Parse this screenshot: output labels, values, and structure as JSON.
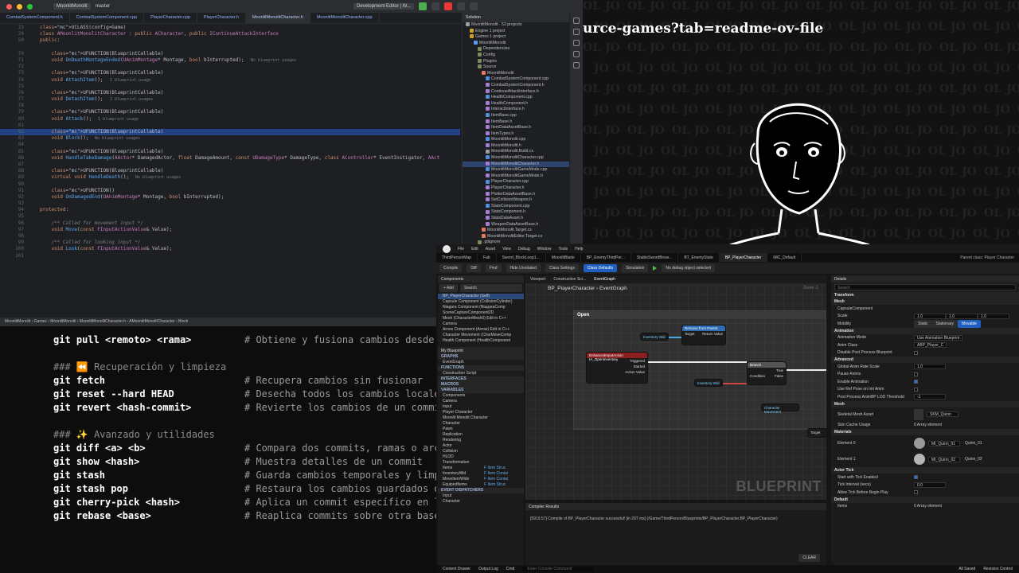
{
  "ide": {
    "menu": {
      "project": "MoonlitMonolit",
      "branch": "master",
      "config": "Development Editor | W..."
    },
    "tabs": [
      "CombatSystemComponent.h",
      "CombatSystemComponent.cpp",
      "PlayerCharacter.cpp",
      "PlayerCharacter.h",
      "MoonlitMonolitCharacter.h",
      "MoonlitMonolitCharacter.cpp"
    ],
    "code": [
      {
        "n": "23",
        "t": "UCLASS(config=Game)"
      },
      {
        "n": "24",
        "t": "class AMoonlitMonolitCharacter : public ACharacter, public IContinueAttackInterface"
      },
      {
        "n": "50",
        "t": "public:"
      },
      {
        "n": "",
        "t": ""
      },
      {
        "n": "70",
        "t": "    UFUNCTION(BlueprintCallable)"
      },
      {
        "n": "71",
        "t": "    void OnDeathMontageEnded(UAnimMontage* Montage, bool bInterrupted);",
        "hint": "No blueprint usages"
      },
      {
        "n": "72",
        "t": ""
      },
      {
        "n": "73",
        "t": "    UFUNCTION(BlueprintCallable)"
      },
      {
        "n": "74",
        "t": "    void AttachItem();",
        "hint": "1 blueprint usage"
      },
      {
        "n": "75",
        "t": ""
      },
      {
        "n": "76",
        "t": "    UFUNCTION(BlueprintCallable)"
      },
      {
        "n": "77",
        "t": "    void DetachItem();",
        "hint": "2 blueprint usages"
      },
      {
        "n": "78",
        "t": ""
      },
      {
        "n": "79",
        "t": "    UFUNCTION(BlueprintCallable)"
      },
      {
        "n": "80",
        "t": "    void Attack();",
        "hint": "1 blueprint usage"
      },
      {
        "n": "81",
        "t": ""
      },
      {
        "n": "82",
        "t": "    UFUNCTION(BlueprintCallable)",
        "hl": true
      },
      {
        "n": "83",
        "t": "    void Block();",
        "hint": "No blueprint usages"
      },
      {
        "n": "84",
        "t": ""
      },
      {
        "n": "85",
        "t": "    UFUNCTION(BlueprintCallable)"
      },
      {
        "n": "86",
        "t": "    void HandleTakeDamage(AActor* DamagedActor, float DamageAmount, const UDamageType* DamageType, class AController* EventInstigator, AAct"
      },
      {
        "n": "87",
        "t": ""
      },
      {
        "n": "88",
        "t": "    UFUNCTION(BlueprintCallable)"
      },
      {
        "n": "89",
        "t": "    virtual void HandleDeath();",
        "hint": "No blueprint usages"
      },
      {
        "n": "90",
        "t": ""
      },
      {
        "n": "91",
        "t": "    UFUNCTION()"
      },
      {
        "n": "92",
        "t": "    void OnDamagedEnd(UAnimMontage* Montage, bool bInterrupted);"
      },
      {
        "n": "93",
        "t": ""
      },
      {
        "n": "94",
        "t": "protected:"
      },
      {
        "n": "95",
        "t": ""
      },
      {
        "n": "96",
        "t": "    /** Called for movement input */"
      },
      {
        "n": "97",
        "t": "    void Move(const FInputActionValue& Value);"
      },
      {
        "n": "98",
        "t": ""
      },
      {
        "n": "99",
        "t": "    /** Called for looking input */"
      },
      {
        "n": "100",
        "t": "    void Look(const FInputActionValue& Value);"
      },
      {
        "n": "101",
        "t": ""
      }
    ],
    "solution": {
      "title": "Solution",
      "items": [
        {
          "t": "MoonlitMonolit · 52 projects",
          "d": 0
        },
        {
          "t": "Engine  1 project",
          "d": 1
        },
        {
          "t": "Games  1 project",
          "d": 1
        },
        {
          "t": "MoonlitMonolit",
          "d": 2
        },
        {
          "t": "Dependencies",
          "d": 3
        },
        {
          "t": "Config",
          "d": 3
        },
        {
          "t": "Plugins",
          "d": 3
        },
        {
          "t": "Source",
          "d": 3
        },
        {
          "t": "MoonlitMonolit",
          "d": 4
        },
        {
          "t": "CombatSystemComponent.cpp",
          "d": 5
        },
        {
          "t": "CombatSystemComponent.h",
          "d": 5
        },
        {
          "t": "ContinueAttackInterface.h",
          "d": 5
        },
        {
          "t": "HealthComponent.cpp",
          "d": 5
        },
        {
          "t": "HealthComponent.h",
          "d": 5
        },
        {
          "t": "InteractInterface.h",
          "d": 5
        },
        {
          "t": "ItemBase.cpp",
          "d": 5
        },
        {
          "t": "ItemBase.h",
          "d": 5
        },
        {
          "t": "ItemDataAssetBase.h",
          "d": 5
        },
        {
          "t": "ItemTypes.h",
          "d": 5
        },
        {
          "t": "MoonlitMonolit.cpp",
          "d": 5
        },
        {
          "t": "MoonlitMonolit.h",
          "d": 5
        },
        {
          "t": "MoonlitMonolit.Build.cs",
          "d": 5
        },
        {
          "t": "MoonlitMonolitCharacter.cpp",
          "d": 5
        },
        {
          "t": "MoonlitMonolitCharacter.h",
          "d": 5,
          "sel": true
        },
        {
          "t": "MoonlitMonolitGameMode.cpp",
          "d": 5
        },
        {
          "t": "MoonlitMonolitGameMode.h",
          "d": 5
        },
        {
          "t": "PlayerCharacter.cpp",
          "d": 5
        },
        {
          "t": "PlayerCharacter.h",
          "d": 5
        },
        {
          "t": "PlotterDataAssetBase.h",
          "d": 5
        },
        {
          "t": "SetCollisionWeapon.h",
          "d": 5
        },
        {
          "t": "StatsComponent.cpp",
          "d": 5
        },
        {
          "t": "StatsComponent.h",
          "d": 5
        },
        {
          "t": "StatsDataAsset.h",
          "d": 5
        },
        {
          "t": "WeaponDataAssetBase.h",
          "d": 5
        },
        {
          "t": "MoonlitMonolit.Target.cs",
          "d": 4
        },
        {
          "t": "MoonlitMonolitEditor.Target.cs",
          "d": 4
        },
        {
          "t": ".gitignore",
          "d": 3
        }
      ]
    },
    "status": "MoonlitMonolit  ›  Games  ›  MoonlitMonolit  ›  MoonlitMonolitCharacter.h  ›  AMoonlitMonolitCharacter  ›  Block"
  },
  "terminal": {
    "lines": [
      {
        "cmd": "git pull <remoto> <rama>",
        "com": "# Obtiene y fusiona cambios desde"
      },
      {
        "head": "### ⏪ Recuperación y limpieza"
      },
      {
        "cmd": "git fetch",
        "com": "# Recupera cambios sin fusionar"
      },
      {
        "cmd": "git reset --hard HEAD",
        "com": "# Desecha todos los cambios locale"
      },
      {
        "cmd": "git revert <hash-commit>",
        "com": "# Revierte los cambios de un commi"
      },
      {
        "head": "### ✨ Avanzado y utilidades"
      },
      {
        "cmd": "git diff <a> <b>",
        "com": "# Compara dos commits, ramas o arc"
      },
      {
        "cmd": "git show <hash>",
        "com": "# Muestra detalles de un commit"
      },
      {
        "cmd": "git stash",
        "com": "# Guarda cambios temporales y limp"
      },
      {
        "cmd": "git stash pop",
        "com": "# Restaura los cambios guardados d"
      },
      {
        "cmd": "git cherry-pick <hash>",
        "com": "# Aplica un commit específico en l"
      },
      {
        "cmd": "git rebase <base>",
        "com": "# Reaplica commits sobre otra base"
      }
    ]
  },
  "overlay": {
    "url": "urce-games?tab=readme-ov-file"
  },
  "ue": {
    "menu": [
      "File",
      "Edit",
      "Asset",
      "View",
      "Debug",
      "Window",
      "Tools",
      "Help"
    ],
    "tabs": [
      "ThirdPersonMap",
      "Fab",
      "Sword_BlockLoop1...",
      "MoonlitBlade",
      "BP_EnemyThirdPer...",
      "StableSwordBrear...",
      "BT_EnemyState",
      "BP_PlayerCharacter",
      "IMC_Default"
    ],
    "parent": "Parent class: Player Character",
    "toolbar": {
      "compile": "Compile",
      "diff": "Diff",
      "find": "Find",
      "hide": "Hide Unrelated",
      "class_settings": "Class Settings",
      "class_defaults": "Class Defaults",
      "simulation": "Simulation",
      "debug": "No debug object selected"
    },
    "components": {
      "title": "Components",
      "add": "+ Add",
      "search": "Search",
      "items": [
        {
          "t": "BP_PlayerCharacter (Self)",
          "sel": true
        },
        {
          "t": "Capsule Component (CollisionCylinder)"
        },
        {
          "t": "Niagara Component (NiagaraComp"
        },
        {
          "t": "SceneCaptureComponent2D"
        },
        {
          "t": "Mesh (CharacterMesh0)  Edit in C++"
        },
        {
          "t": "Camera"
        },
        {
          "t": "Arrow Component (Arrow)  Edit in C++"
        },
        {
          "t": "Character Movement (CharMoveComp"
        },
        {
          "t": "Health Component (HealthComponent"
        }
      ]
    },
    "myblueprint": {
      "title": "My Blueprint",
      "sections": [
        "GRAPHS",
        "FUNCTIONS",
        "INTERFACES",
        "MACROS",
        "VARIABLES",
        "EVENT DISPATCHERS"
      ],
      "graph": "EventGraph",
      "function": "Construction Script",
      "override": "Override",
      "variables": [
        "Components",
        "Camera",
        "Input",
        "Player Character",
        "Moonlit Monolit Character",
        "Character",
        "Pawn",
        "Replication",
        "Rendering",
        "Actor",
        "Collision",
        "HLOD",
        "Transformation"
      ],
      "vars": [
        {
          "name": "Items",
          "type": "F Item Struc"
        },
        {
          "name": "InventoryWid",
          "type": "F Item Contai"
        },
        {
          "name": "MoveItemWide",
          "type": "F Item Contai"
        },
        {
          "name": "EquipedItems",
          "type": "F Item Struc"
        }
      ],
      "dispatchers": [
        "Input",
        "Character"
      ]
    },
    "graph": {
      "tabs": [
        "Viewport",
        "Construction Scr...",
        "EventGraph"
      ],
      "breadcrumb": "BP_PlayerCharacter  ›  EventGraph",
      "zoom": "Zoom -1",
      "comment": "Open",
      "watermark": "BLUEPRINT",
      "nodes": {
        "inv": "Inventory Wid",
        "remove": "Remove from Parent",
        "target": "Target",
        "return": "Return Value",
        "enhanced": "EnhancedInputAction IA_OpenInventory",
        "triggered": "Triggered",
        "started": "Started",
        "action": "Action Value",
        "inv2": "Inventory Wid",
        "branch": "Branch",
        "condition": "Condition",
        "true": "True",
        "false": "False",
        "charmove": "Character Movement",
        "target2": "Target"
      }
    },
    "compiler": {
      "title": "Compiler Results",
      "log": "[5919.57] Compile of BP_PlayerCharacter successful! [in 297 ms] (/Game/ThirdPerson/Blueprints/BP_PlayerCharacter.BP_PlayerCharacter)",
      "clear": "CLEAR"
    },
    "details": {
      "title": "Details",
      "search": "Search",
      "sections": [
        "Transform",
        "Mesh",
        "Animation",
        "Advanced",
        "Mesh",
        "Materials",
        "Actor Tick",
        "Default"
      ],
      "capsule": "CapsuleComponent",
      "scale_label": "Scale",
      "scale": [
        "1.0",
        "1.0",
        "1.0"
      ],
      "mobility_label": "Mobility",
      "mobility": [
        "Static",
        "Stationary",
        "Movable"
      ],
      "anim_mode_label": "Animation Mode",
      "anim_mode": "Use Animation Blueprint",
      "anim_class_label": "Anim Class",
      "anim_class": "ABP_Player_C",
      "disable_post": "Disable Post Process Blueprint",
      "global_rate_label": "Global Anim Rate Scale",
      "global_rate": "1.0",
      "pause": "Pause Anims",
      "enable_anim": "Enable Animation",
      "use_ref": "Use Ref Pose on Init Anim",
      "lod_label": "Post Process AnimBP LOD Threshold",
      "lod": "-1",
      "skel_label": "Skeletal Mesh Asset",
      "skel": "SKM_Quinn",
      "skin_label": "Skin Cache Usage",
      "skin": "0 Array element",
      "el0_label": "Element 0",
      "el0": "MI_Quinn_01",
      "el0_b": "Quinn_01",
      "el1_label": "Element 1",
      "el1": "MI_Quinn_02",
      "el1_b": "Quinn_02",
      "tick_start": "Start with Tick Enabled",
      "tick_int_label": "Tick Interval (secs)",
      "tick_int": "0.0",
      "allow_tick": "Allow Tick Before Begin Play",
      "items_label": "Items",
      "items": "0 Array element"
    },
    "status": [
      "Content Drawer",
      "Output Log",
      "Cmd",
      "Enter Console Command"
    ],
    "status_right": [
      "All Saved",
      "Revision Control"
    ]
  }
}
